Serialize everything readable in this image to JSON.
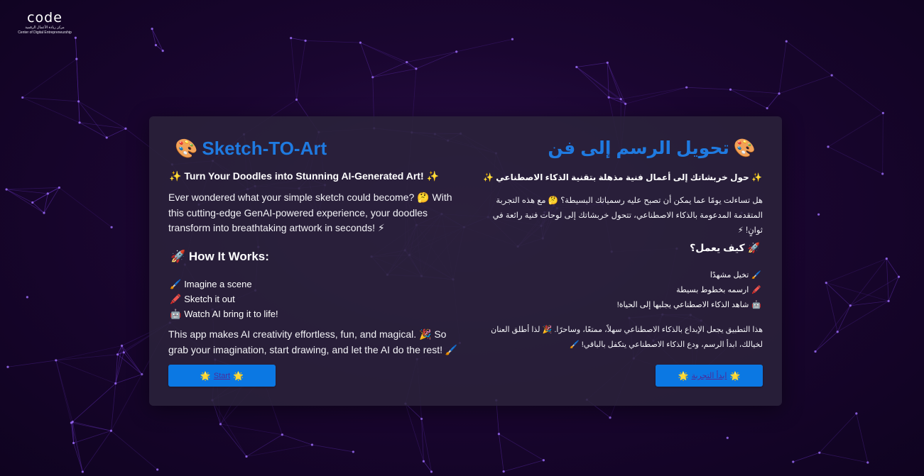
{
  "logo": {
    "wordmark": "code",
    "arabic_name": "مركز ريادة الأعمال الرقمية",
    "english_name": "Center of Digital Entrepreneurship"
  },
  "english": {
    "title_emoji": "🎨",
    "title": "Sketch-TO-Art",
    "subtitle": "✨ Turn Your Doodles into Stunning AI-Generated Art! ✨",
    "intro": "Ever wondered what your simple sketch could become? 🤔 With this cutting-edge GenAI-powered experience, your doodles transform into breathtaking artwork in seconds! ⚡",
    "how_title": "🚀 How It Works:",
    "steps": [
      {
        "icon": "🖌️",
        "text": "Imagine a scene"
      },
      {
        "icon": "🖍️",
        "text": "Sketch it out"
      },
      {
        "icon": "🤖",
        "text": "Watch AI bring it to life!"
      }
    ],
    "outro": "This app makes AI creativity effortless, fun, and magical. 🎉 So grab your imagination, start drawing, and let the AI do the rest! 🖌️",
    "button_label": "Start",
    "button_icon": "🌟"
  },
  "arabic": {
    "title_emoji": "🎨",
    "title": "تحويل الرسم إلى فن",
    "subtitle": "✨ حول خربشاتك إلى أعمال فنية مذهلة بتقنية الذكاء الاصطناعي ✨",
    "intro": "هل تساءلت يومًا عما يمكن أن تصبح عليه رسمياتك البسيطة؟ 🤔 مع هذه التجربة المتقدمة المدعومة بالذكاء الاصطناعي، تتحول خربشاتك إلى لوحات فنية رائعة في ثوانٍ! ⚡",
    "how_title": "🚀 كيف يعمل؟",
    "steps": [
      {
        "icon": "🖌️",
        "text": "تخيل مشهدًا"
      },
      {
        "icon": "🖍️",
        "text": "ارسمه بخطوط بسيطة"
      },
      {
        "icon": "🤖",
        "text": "شاهد الذكاء الاصطناعي يجلبها إلى الحياة!"
      }
    ],
    "outro": "هذا التطبيق يجعل الإبداع بالذكاء الاصطناعي سهلاً، ممتعًا، وساحرًا. 🎉 لذا أطلق العنان لخيالك، ابدأ الرسم، ودع الذكاء الاصطناعي يتكفل بالباقي! 🖌️",
    "button_label": "ابدأ التجربة",
    "button_icon": "🌟"
  },
  "colors": {
    "accent_blue": "#1f7ae0",
    "button_blue": "#0b78e3",
    "background": "#1a0630",
    "network_lines": "#7b3fe4"
  }
}
